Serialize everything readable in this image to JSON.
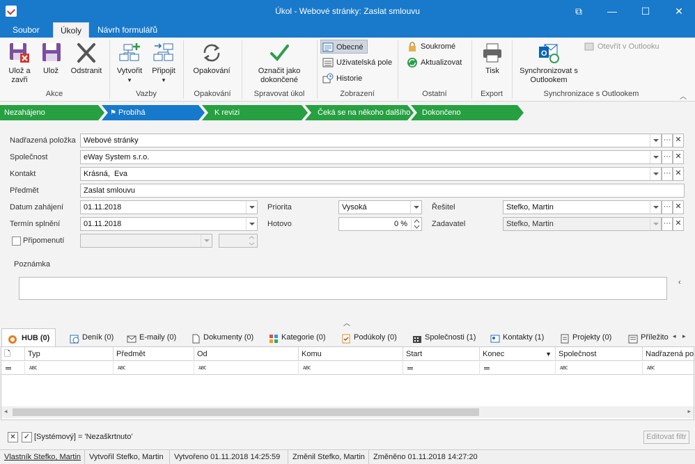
{
  "window": {
    "title": "Úkol - Webové stránky: Zaslat smlouvu",
    "controls": [
      "⧉",
      "—",
      "☐",
      "✕"
    ]
  },
  "ribbon_tabs": [
    {
      "label": "Soubor",
      "active": false
    },
    {
      "label": "Úkoly",
      "active": true
    },
    {
      "label": "Návrh formulářů",
      "active": false
    }
  ],
  "ribbon": {
    "akce": {
      "label": "Akce",
      "save_close": "Ulož a zavři",
      "save": "Ulož",
      "delete": "Odstranit"
    },
    "vazby": {
      "label": "Vazby",
      "create": "Vytvořit",
      "attach": "Připojit"
    },
    "opakovani": {
      "label": "Opakování",
      "recurrence": "Opakování"
    },
    "spravovat": {
      "label": "Spravovat úkol",
      "mark_done": "Označit jako dokončené"
    },
    "zobrazeni": {
      "label": "Zobrazení",
      "general": "Obecné",
      "user_fields": "Uživatelská pole",
      "history": "Historie"
    },
    "ostatni": {
      "label": "Ostatní",
      "private": "Soukromé",
      "refresh": "Aktualizovat"
    },
    "export": {
      "label": "Export",
      "print": "Tisk"
    },
    "sync": {
      "label": "Synchronizace s Outlookem",
      "sync_btn": "Synchronizovat s Outlookem",
      "open_outlook": "Otevřít v Outlooku"
    }
  },
  "stages": [
    {
      "label": "Nezahájeno",
      "state": "done"
    },
    {
      "label": "Probíhá",
      "state": "current"
    },
    {
      "label": "K revizi",
      "state": "done"
    },
    {
      "label": "Čeká se na někoho dalšího",
      "state": "done"
    },
    {
      "label": "Dokončeno",
      "state": "done"
    }
  ],
  "form": {
    "parent_label": "Nadřazená položka",
    "parent_value": "Webové stránky",
    "company_label": "Společnost",
    "company_value": "eWay System s.r.o.",
    "contact_label": "Kontakt",
    "contact_value": "Krásná,  Eva",
    "subject_label": "Předmět",
    "subject_value": "Zaslat smlouvu",
    "start_label": "Datum zahájení",
    "start_value": "01.11.2018",
    "due_label": "Termín splnění",
    "due_value": "01.11.2018",
    "reminder_label": "Připomenutí",
    "priority_label": "Priorita",
    "priority_value": "Vysoká",
    "done_label": "Hotovo",
    "done_value": "0 %",
    "solver_label": "Řešitel",
    "solver_value": "Stefko, Martin",
    "assigner_label": "Zadavatel",
    "assigner_value": "Stefko, Martin",
    "note_label": "Poznámka",
    "ellipsis": "···",
    "clear": "✕"
  },
  "bottom_tabs": [
    {
      "label": "HUB (0)",
      "icon": "hub-icon"
    },
    {
      "label": "Deník (0)",
      "icon": "journal-icon"
    },
    {
      "label": "E-maily (0)",
      "icon": "email-icon"
    },
    {
      "label": "Dokumenty (0)",
      "icon": "document-icon"
    },
    {
      "label": "Kategorie (0)",
      "icon": "category-icon"
    },
    {
      "label": "Podúkoly (0)",
      "icon": "subtask-icon"
    },
    {
      "label": "Společnosti (1)",
      "icon": "company-icon"
    },
    {
      "label": "Kontakty (1)",
      "icon": "contact-icon"
    },
    {
      "label": "Projekty (0)",
      "icon": "project-icon"
    },
    {
      "label": "Příležito",
      "icon": "opportunity-icon"
    }
  ],
  "grid": {
    "columns": [
      "Typ",
      "Předmět",
      "Od",
      "Komu",
      "Start",
      "Konec",
      "Společnost",
      "Nadřazená po"
    ],
    "abc": "ABC"
  },
  "filter": {
    "text": "[Systémový] = 'Nezaškrtnuto'",
    "edit_button": "Editovat filtr"
  },
  "status": {
    "owner": "Vlastník Stefko, Martin",
    "created_by": "Vytvořil Stefko, Martin",
    "created_at": "Vytvořeno 01.11.2018 14:25:59",
    "changed_by": "Změnil Stefko, Martin",
    "changed_at": "Změněno 01.11.2018 14:27:20"
  },
  "colors": {
    "titlebar": "#1979ca",
    "stage_green": "#27a042",
    "stage_blue": "#1779cc"
  }
}
